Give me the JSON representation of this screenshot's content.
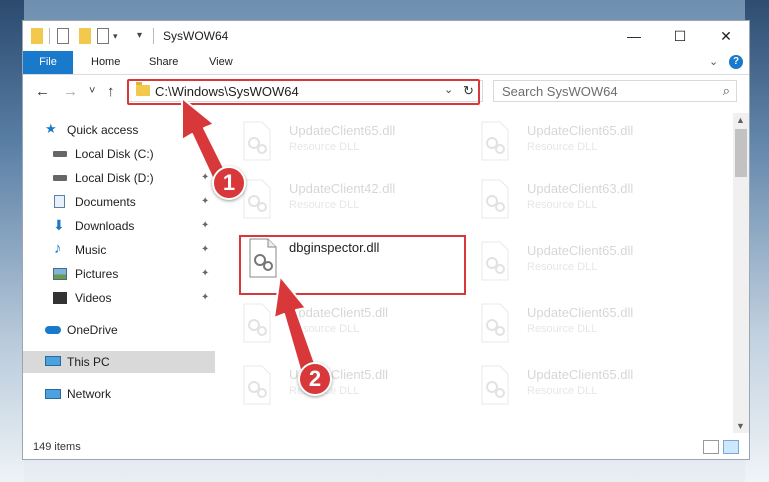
{
  "window": {
    "title": "SysWOW64",
    "controls": {
      "minimize": "—",
      "maximize": "☐",
      "close": "✕"
    }
  },
  "ribbon": {
    "file": "File",
    "tabs": [
      "Home",
      "Share",
      "View"
    ],
    "expand": "⌄",
    "help": "?"
  },
  "nav": {
    "back": "←",
    "forward": "→",
    "recent": "˅",
    "up": "↑",
    "address": "C:\\Windows\\SysWOW64",
    "address_dropdown": "⌄",
    "refresh": "↻",
    "search_placeholder": "Search SysWOW64",
    "search_icon": "⌕"
  },
  "sidebar": {
    "quick_access": "Quick access",
    "items": [
      {
        "label": "Local Disk (C:)",
        "icon": "drive-icon"
      },
      {
        "label": "Local Disk (D:)",
        "icon": "drive-icon"
      },
      {
        "label": "Documents",
        "icon": "documents-icon"
      },
      {
        "label": "Downloads",
        "icon": "downloads-icon"
      },
      {
        "label": "Music",
        "icon": "music-icon"
      },
      {
        "label": "Pictures",
        "icon": "pictures-icon"
      },
      {
        "label": "Videos",
        "icon": "videos-icon"
      }
    ],
    "onedrive": "OneDrive",
    "thispc": "This PC",
    "network": "Network",
    "pin": "📌"
  },
  "files": {
    "left": [
      {
        "name": "UpdateClient65.dll",
        "type": "Resource DLL"
      },
      {
        "name": "UpdateClient42.dll",
        "type": "Resource DLL"
      },
      {
        "name": "dbginspector.dll",
        "type": ""
      },
      {
        "name": "UpdateClient5.dll",
        "type": "Resource DLL"
      },
      {
        "name": "UpdateClient5.dll",
        "type": "Resource DLL"
      }
    ],
    "right": [
      {
        "name": "UpdateClient65.dll",
        "type": "Resource DLL"
      },
      {
        "name": "UpdateClient63.dll",
        "type": "Resource DLL"
      },
      {
        "name": "UpdateClient65.dll",
        "type": "Resource DLL"
      },
      {
        "name": "UpdateClient65.dll",
        "type": "Resource DLL"
      },
      {
        "name": "UpdateClient65.dll",
        "type": "Resource DLL"
      }
    ]
  },
  "status": {
    "items": "149 items"
  },
  "annotations": {
    "step1": "1",
    "step2": "2"
  },
  "colors": {
    "accent": "#1979ca",
    "highlight": "#d9383a"
  }
}
